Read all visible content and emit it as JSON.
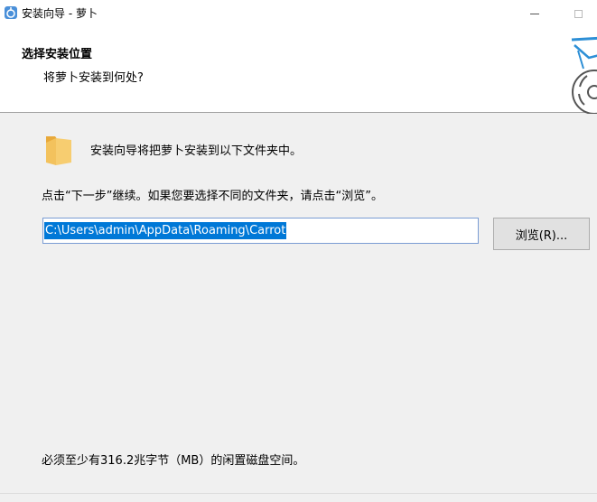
{
  "window": {
    "title": "安装向导 - 萝卜",
    "app_icon": "installer-app-icon",
    "controls": {
      "minimize_icon": "minimize-icon",
      "maximize_icon": "maximize-icon"
    }
  },
  "header": {
    "title": "选择安装位置",
    "subtitle": "将萝卜安装到何处?",
    "image_icon": "installer-disc-icon"
  },
  "body": {
    "folder_icon": "folder-icon",
    "info_text": "安装向导将把萝卜安装到以下文件夹中。",
    "instruction_text": "点击“下一步”继续。如果您要选择不同的文件夹，请点击“浏览”。",
    "path_value": "C:\\Users\\admin\\AppData\\Roaming\\Carrot",
    "browse_label": "浏览(R)...",
    "space_text": "必须至少有316.2兆字节（MB）的闲置磁盘空间。"
  },
  "colors": {
    "selection": "#0078d7",
    "folder": "#f3c25d",
    "header_bg": "#ffffff",
    "body_bg": "#f0f0f0"
  }
}
